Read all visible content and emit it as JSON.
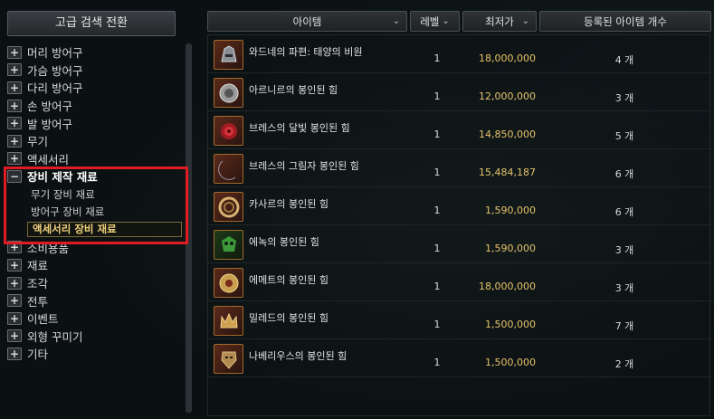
{
  "left": {
    "advanced_search_button": "고급 검색 전환",
    "categories_before": [
      {
        "label": "머리 방어구",
        "toggle": "+"
      },
      {
        "label": "가슴 방어구",
        "toggle": "+"
      },
      {
        "label": "다리 방어구",
        "toggle": "+"
      },
      {
        "label": "손 방어구",
        "toggle": "+"
      },
      {
        "label": "발 방어구",
        "toggle": "+"
      },
      {
        "label": "무기",
        "toggle": "+"
      },
      {
        "label": "액세서리",
        "toggle": "+"
      }
    ],
    "expanded_category": {
      "label": "장비 제작 재료",
      "toggle": "−"
    },
    "subcategories": [
      {
        "label": "무기 장비 재료"
      },
      {
        "label": "방어구 장비 재료"
      },
      {
        "label": "액세서리 장비 재료",
        "selected": true
      }
    ],
    "categories_after": [
      {
        "label": "소비용품",
        "toggle": "+"
      },
      {
        "label": "재료",
        "toggle": "+"
      },
      {
        "label": "조각",
        "toggle": "+"
      },
      {
        "label": "전투",
        "toggle": "+"
      },
      {
        "label": "이벤트",
        "toggle": "+"
      },
      {
        "label": "외형 꾸미기",
        "toggle": "+"
      },
      {
        "label": "기타",
        "toggle": "+"
      }
    ]
  },
  "table": {
    "headers": {
      "item": "아이템",
      "level": "레벨",
      "min_price": "최저가",
      "registered_count": "등록된 아이템 개수"
    },
    "rows": [
      {
        "name": "와드네의 파편: 태양의 비원",
        "level": "1",
        "price": "18,000,000",
        "count": "4 개",
        "icon": "helmet-icon"
      },
      {
        "name": "아르니르의 봉인된 힘",
        "level": "1",
        "price": "12,000,000",
        "count": "3 개",
        "icon": "crest-icon"
      },
      {
        "name": "브레스의 달빛 봉인된 힘",
        "level": "1",
        "price": "14,850,000",
        "count": "5 개",
        "icon": "rose-icon"
      },
      {
        "name": "브레스의 그림자 봉인된 힘",
        "level": "1",
        "price": "15,484,187",
        "count": "6 개",
        "icon": "crescent-icon"
      },
      {
        "name": "카사르의 봉인된 힘",
        "level": "1",
        "price": "1,590,000",
        "count": "6 개",
        "icon": "ring-icon"
      },
      {
        "name": "에녹의 봉인된 힘",
        "level": "1",
        "price": "1,590,000",
        "count": "3 개",
        "icon": "skull-icon"
      },
      {
        "name": "에메트의 봉인된 힘",
        "level": "1",
        "price": "18,000,000",
        "count": "3 개",
        "icon": "orb-icon"
      },
      {
        "name": "밀레드의 봉인된 힘",
        "level": "1",
        "price": "1,500,000",
        "count": "7 개",
        "icon": "crown-icon"
      },
      {
        "name": "나베리우스의 봉인된 힘",
        "level": "1",
        "price": "1,500,000",
        "count": "2 개",
        "icon": "mask-icon"
      }
    ]
  },
  "colors": {
    "price": "#e6c36a",
    "highlight_border": "#e01b24",
    "selected_text": "#f0d27a"
  }
}
